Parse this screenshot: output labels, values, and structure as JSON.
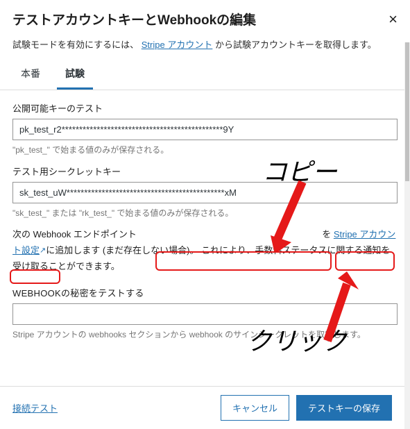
{
  "header": {
    "title": "テストアカウントキーとWebhookの編集"
  },
  "intro": {
    "prefix": "試験モードを有効にするには、",
    "link_text": "Stripe アカウント",
    "suffix": "から試験アカウントキーを取得します。"
  },
  "tabs": {
    "production": "本番",
    "test": "試験"
  },
  "fields": {
    "publishable": {
      "label": "公開可能キーのテスト",
      "value": "pk_test_r2**********************************************9Y",
      "helper": "\"pk_test_\" で始まる値のみが保存される。"
    },
    "secret": {
      "label": "テスト用シークレットキー",
      "value": "sk_test_uW*********************************************xM",
      "helper": "\"sk_test_\" または \"rk_test_\" で始まる値のみが保存される。"
    },
    "webhook_desc": {
      "prefix": "次の Webhook エンドポイント",
      "endpoint_masked": "　　　　　　　　　　　　　　　　　　　　",
      "middle": "を",
      "link_text": "Stripe アカウント設定",
      "suffix": "に追加します (まだ存在しない場合)。 これにより、手数料ステータスに関する通知を受け取ることができます。"
    },
    "webhook_secret": {
      "label": "WEBHOOKの秘密をテストする",
      "value": "",
      "helper": "Stripe アカウントの webhooks セクションから webhook のサインシークレットを取得します。"
    }
  },
  "footer": {
    "connection_test": "接続テスト",
    "cancel": "キャンセル",
    "save": "テストキーの保存"
  },
  "annotations": {
    "copy": "コピー",
    "click": "クリック"
  }
}
